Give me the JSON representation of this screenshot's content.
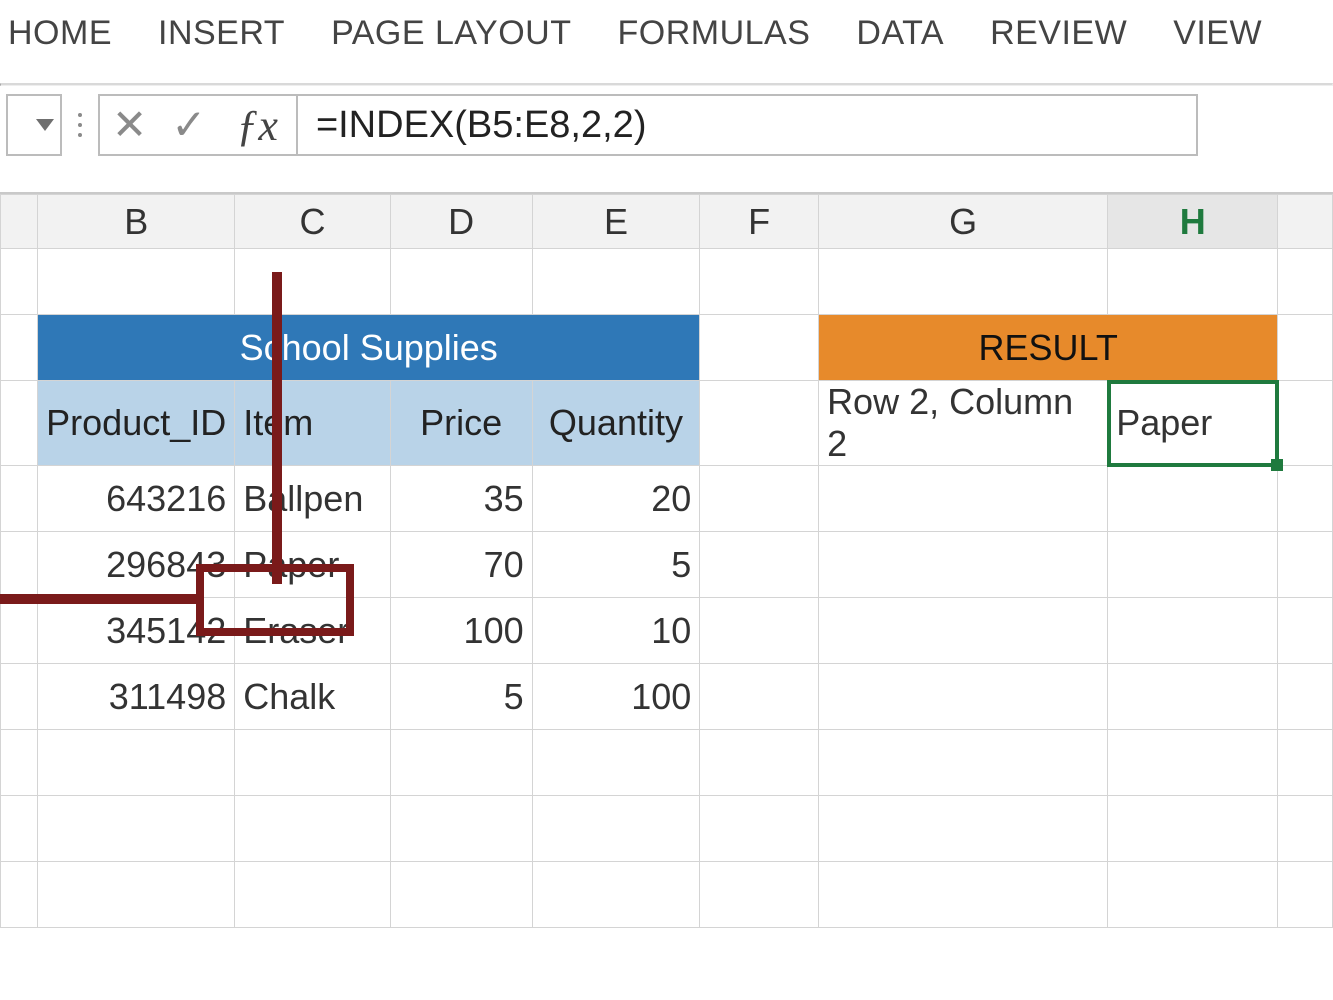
{
  "ribbon": {
    "tabs": [
      "HOME",
      "INSERT",
      "PAGE LAYOUT",
      "FORMULAS",
      "DATA",
      "REVIEW",
      "VIEW"
    ]
  },
  "formula_bar": {
    "formula": "=INDEX(B5:E8,2,2)"
  },
  "columns": [
    "B",
    "C",
    "D",
    "E",
    "F",
    "G",
    "H"
  ],
  "active_column": "H",
  "titles": {
    "left": "School Supplies",
    "right": "RESULT"
  },
  "headers": {
    "product_id": "Product_ID",
    "item": "Item",
    "price": "Price",
    "quantity": "Quantity"
  },
  "rows": [
    {
      "product_id": "643216",
      "item": "Ballpen",
      "price": "35",
      "quantity": "20"
    },
    {
      "product_id": "296843",
      "item": "Paper",
      "price": "70",
      "quantity": "5"
    },
    {
      "product_id": "345142",
      "item": "Eraser",
      "price": "100",
      "quantity": "10"
    },
    {
      "product_id": "311498",
      "item": "Chalk",
      "price": "5",
      "quantity": "100"
    }
  ],
  "result": {
    "label": "Row 2, Column 2",
    "value": "Paper"
  },
  "chart_data": {
    "type": "table",
    "title": "School Supplies",
    "columns": [
      "Product_ID",
      "Item",
      "Price",
      "Quantity"
    ],
    "rows": [
      [
        643216,
        "Ballpen",
        35,
        20
      ],
      [
        296843,
        "Paper",
        70,
        5
      ],
      [
        345142,
        "Eraser",
        100,
        10
      ],
      [
        311498,
        "Chalk",
        5,
        100
      ]
    ],
    "formula": "=INDEX(B5:E8,2,2)",
    "result_label": "Row 2, Column 2",
    "result_value": "Paper"
  }
}
